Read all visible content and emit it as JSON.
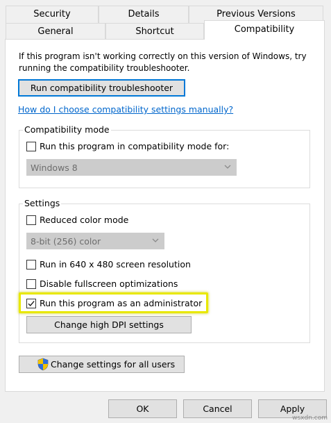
{
  "tabs_row1": [
    {
      "label": "Security"
    },
    {
      "label": "Details"
    },
    {
      "label": "Previous Versions"
    }
  ],
  "tabs_row2": [
    {
      "label": "General"
    },
    {
      "label": "Shortcut"
    },
    {
      "label": "Compatibility",
      "active": true
    }
  ],
  "intro_text_line1": "If this program isn't working correctly on this version of Windows, try",
  "intro_text_line2": "running the compatibility troubleshooter.",
  "troubleshooter_button": "Run compatibility troubleshooter",
  "help_link": "How do I choose compatibility settings manually?",
  "compat_mode": {
    "legend": "Compatibility mode",
    "checkbox_label": "Run this program in compatibility mode for:",
    "checked": false,
    "select_value": "Windows 8"
  },
  "settings": {
    "legend": "Settings",
    "reduced_color": {
      "label": "Reduced color mode",
      "checked": false
    },
    "color_select_value": "8-bit (256) color",
    "resolution": {
      "label": "Run in 640 x 480 screen resolution",
      "checked": false
    },
    "fullscreen": {
      "label": "Disable fullscreen optimizations",
      "checked": false
    },
    "admin": {
      "label": "Run this program as an administrator",
      "checked": true
    },
    "dpi_button": "Change high DPI settings"
  },
  "all_users_button": "Change settings for all users",
  "footer": {
    "ok": "OK",
    "cancel": "Cancel",
    "apply": "Apply"
  },
  "watermark": "wsxdn.com",
  "colors": {
    "highlight": "#e8e800",
    "link": "#0066cc",
    "focus_border": "#0078d7",
    "check_mark": "#1a1a1a"
  }
}
